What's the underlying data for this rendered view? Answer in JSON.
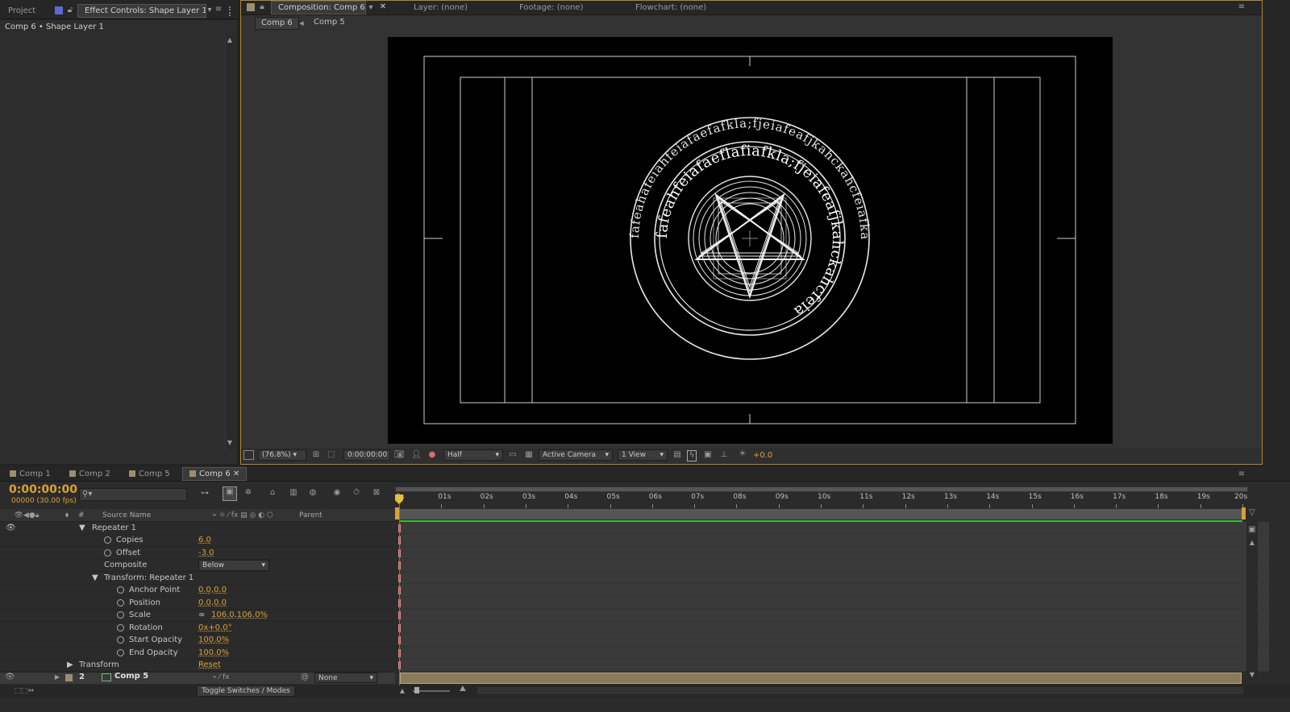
{
  "left_panel": {
    "tabs": [
      {
        "label": "Project"
      },
      {
        "label": "Effect Controls: Shape Layer 1"
      }
    ],
    "breadcrumb": "Comp 6 • Shape Layer 1"
  },
  "viewer": {
    "tabs": [
      {
        "label": "Composition: Comp 6"
      },
      {
        "label": "Layer: (none)"
      },
      {
        "label": "Footage: (none)"
      },
      {
        "label": "Flowchart: (none)"
      }
    ],
    "nav": {
      "current": "Comp 6",
      "previous": "Comp 5"
    },
    "footer": {
      "zoom": "(76.8%)",
      "timecode": "0:00:00:00",
      "resolution": "Half",
      "camera": "Active Camera",
      "views": "1 View",
      "exposure": "+0.0"
    }
  },
  "timeline": {
    "tabs": [
      {
        "label": "Comp 1"
      },
      {
        "label": "Comp 2"
      },
      {
        "label": "Comp 5"
      },
      {
        "label": "Comp 6"
      }
    ],
    "timecode": "0:00:00:00",
    "frames": "00000 (30.00 fps)",
    "columns": {
      "number": "#",
      "source_name": "Source Name",
      "parent": "Parent"
    },
    "ruler": [
      "0s",
      "01s",
      "02s",
      "03s",
      "04s",
      "05s",
      "06s",
      "07s",
      "08s",
      "09s",
      "10s",
      "11s",
      "12s",
      "13s",
      "14s",
      "15s",
      "16s",
      "17s",
      "18s",
      "19s",
      "20s"
    ],
    "properties": [
      {
        "label": "Repeater 1",
        "value": "",
        "indent": 1,
        "twirl": "open"
      },
      {
        "label": "Copies",
        "value": "6.0",
        "indent": 2
      },
      {
        "label": "Offset",
        "value": "-3.0",
        "indent": 2
      },
      {
        "label": "Composite",
        "value": "Below",
        "indent": 2,
        "dropdown": true
      },
      {
        "label": "Transform: Repeater 1",
        "value": "",
        "indent": 2,
        "twirl": "open"
      },
      {
        "label": "Anchor Point",
        "value": "0.0,0.0",
        "indent": 3
      },
      {
        "label": "Position",
        "value": "0.0,0.0",
        "indent": 3
      },
      {
        "label": "Scale",
        "value": "106.0,106.0%",
        "indent": 3,
        "link": true
      },
      {
        "label": "Rotation",
        "value": "0x+0.0°",
        "indent": 3
      },
      {
        "label": "Start Opacity",
        "value": "100.0%",
        "indent": 3
      },
      {
        "label": "End Opacity",
        "value": "100.0%",
        "indent": 3
      },
      {
        "label": "Transform",
        "value": "Reset",
        "indent": 0,
        "twirl": "closed"
      }
    ],
    "layer": {
      "number": "2",
      "name": "Comp 5",
      "parent": "None"
    },
    "toggle_label": "Toggle Switches / Modes"
  },
  "composition": {
    "ring_text_outer": "fafeahafeiahfeiafaefafkla;fjeiafeafjkahckahcfeiafka",
    "ring_text_inner": "fafeahfeiafaeflafiafkla;fjeiafeafjkahckahcfeia"
  },
  "colors": {
    "accent": "#d8a236",
    "work_area": "#2fc32f",
    "layer_bar": "#8a7a5c"
  }
}
